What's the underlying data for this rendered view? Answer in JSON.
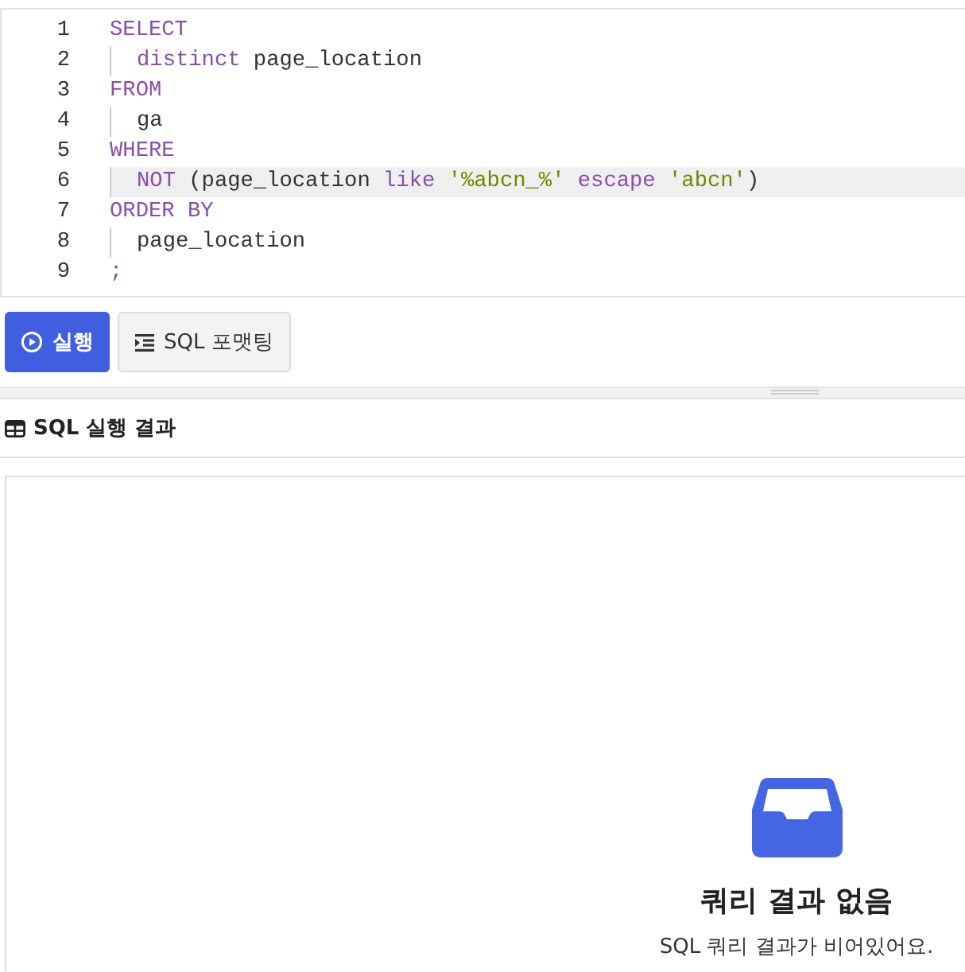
{
  "editor": {
    "lines": [
      {
        "number": "1",
        "indent": false,
        "active": false,
        "tokens": [
          {
            "kind": "keyword",
            "text": "SELECT"
          }
        ]
      },
      {
        "number": "2",
        "indent": true,
        "active": false,
        "tokens": [
          {
            "kind": "keyword",
            "text": "distinct"
          },
          {
            "kind": "plain",
            "text": " page_location"
          }
        ]
      },
      {
        "number": "3",
        "indent": false,
        "active": false,
        "tokens": [
          {
            "kind": "keyword",
            "text": "FROM"
          }
        ]
      },
      {
        "number": "4",
        "indent": true,
        "active": false,
        "tokens": [
          {
            "kind": "plain",
            "text": "ga"
          }
        ]
      },
      {
        "number": "5",
        "indent": false,
        "active": false,
        "tokens": [
          {
            "kind": "keyword",
            "text": "WHERE"
          }
        ]
      },
      {
        "number": "6",
        "indent": true,
        "active": true,
        "tokens": [
          {
            "kind": "keyword",
            "text": "NOT"
          },
          {
            "kind": "plain",
            "text": " (page_location "
          },
          {
            "kind": "keyword",
            "text": "like"
          },
          {
            "kind": "string",
            "text": " '%abcn_%'"
          },
          {
            "kind": "keyword",
            "text": " escape"
          },
          {
            "kind": "string",
            "text": " 'abcn'"
          },
          {
            "kind": "plain",
            "text": ")"
          }
        ]
      },
      {
        "number": "7",
        "indent": false,
        "active": false,
        "tokens": [
          {
            "kind": "keyword",
            "text": "ORDER BY"
          }
        ]
      },
      {
        "number": "8",
        "indent": true,
        "active": false,
        "tokens": [
          {
            "kind": "plain",
            "text": "page_location"
          }
        ]
      },
      {
        "number": "9",
        "indent": false,
        "active": false,
        "tokens": [
          {
            "kind": "keyword",
            "text": ";"
          }
        ]
      }
    ]
  },
  "buttons": [
    {
      "kind": "run",
      "label": "실행"
    },
    {
      "kind": "format",
      "label": "SQL 포맷팅"
    }
  ],
  "results": {
    "title": "SQL 실행 결과",
    "empty_title": "쿼리 결과 없음",
    "empty_message": "SQL 쿼리 결과가 비어있어요."
  }
}
